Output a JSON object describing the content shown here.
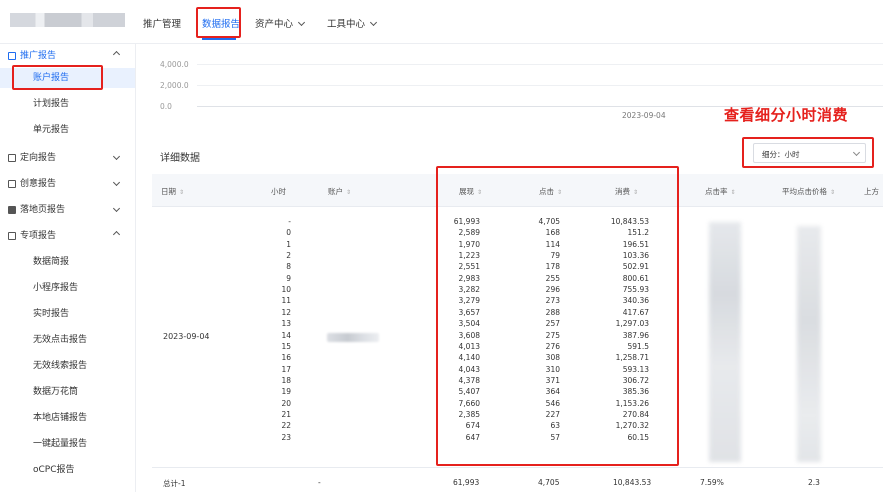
{
  "topnav": {
    "items": [
      {
        "label": "推广管理"
      },
      {
        "label": "数据报告"
      },
      {
        "label": "资产中心"
      },
      {
        "label": "工具中心"
      }
    ]
  },
  "sidebar": {
    "groups": [
      {
        "label": "推广报告"
      },
      {
        "label": "定向报告"
      },
      {
        "label": "创意报告"
      },
      {
        "label": "落地页报告"
      },
      {
        "label": "专项报告"
      }
    ],
    "promo_sub": [
      "账户报告",
      "计划报告",
      "单元报告"
    ],
    "special_sub": [
      "数据简报",
      "小程序报告",
      "实时报告",
      "无效点击报告",
      "无效线索报告",
      "数据万花筒",
      "本地店铺报告",
      "一键起量报告",
      "oCPC报告"
    ]
  },
  "chart": {
    "yticks": [
      "4,000.0",
      "2,000.0",
      "0.0"
    ],
    "xlabel": "2023-09-04"
  },
  "annotation": "查看细分小时消费",
  "detail": {
    "title": "详细数据",
    "segment_select": "细分：小时"
  },
  "table": {
    "headers": {
      "date": "日期",
      "hour": "小时",
      "account": "账户",
      "impressions": "展现",
      "clicks": "点击",
      "cost": "消费",
      "ctr": "点击率",
      "avg_cpc": "平均点击价格",
      "top": "上方"
    },
    "date_value": "2023-09-04",
    "rows": [
      {
        "hour": "-",
        "impressions": "61,993",
        "clicks": "4,705",
        "cost": "10,843.53"
      },
      {
        "hour": "0",
        "impressions": "2,589",
        "clicks": "168",
        "cost": "151.2"
      },
      {
        "hour": "1",
        "impressions": "1,970",
        "clicks": "114",
        "cost": "196.51"
      },
      {
        "hour": "2",
        "impressions": "1,223",
        "clicks": "79",
        "cost": "103.36"
      },
      {
        "hour": "8",
        "impressions": "2,551",
        "clicks": "178",
        "cost": "502.91"
      },
      {
        "hour": "9",
        "impressions": "2,983",
        "clicks": "255",
        "cost": "800.61"
      },
      {
        "hour": "10",
        "impressions": "3,282",
        "clicks": "296",
        "cost": "755.93"
      },
      {
        "hour": "11",
        "impressions": "3,279",
        "clicks": "273",
        "cost": "340.36"
      },
      {
        "hour": "12",
        "impressions": "3,657",
        "clicks": "288",
        "cost": "417.67"
      },
      {
        "hour": "13",
        "impressions": "3,504",
        "clicks": "257",
        "cost": "1,297.03"
      },
      {
        "hour": "14",
        "impressions": "3,608",
        "clicks": "275",
        "cost": "387.96"
      },
      {
        "hour": "15",
        "impressions": "4,013",
        "clicks": "276",
        "cost": "591.5"
      },
      {
        "hour": "16",
        "impressions": "4,140",
        "clicks": "308",
        "cost": "1,258.71"
      },
      {
        "hour": "17",
        "impressions": "4,043",
        "clicks": "310",
        "cost": "593.13"
      },
      {
        "hour": "18",
        "impressions": "4,378",
        "clicks": "371",
        "cost": "306.72"
      },
      {
        "hour": "19",
        "impressions": "5,407",
        "clicks": "364",
        "cost": "385.36"
      },
      {
        "hour": "20",
        "impressions": "7,660",
        "clicks": "546",
        "cost": "1,153.26"
      },
      {
        "hour": "21",
        "impressions": "2,385",
        "clicks": "227",
        "cost": "270.84"
      },
      {
        "hour": "22",
        "impressions": "674",
        "clicks": "63",
        "cost": "1,270.32"
      },
      {
        "hour": "23",
        "impressions": "647",
        "clicks": "57",
        "cost": "60.15"
      }
    ],
    "total": {
      "label": "总计-1",
      "hour": "-",
      "impressions": "61,993",
      "clicks": "4,705",
      "cost": "10,843.53",
      "ctr": "7.59%",
      "avg_cpc": "2.3"
    }
  }
}
